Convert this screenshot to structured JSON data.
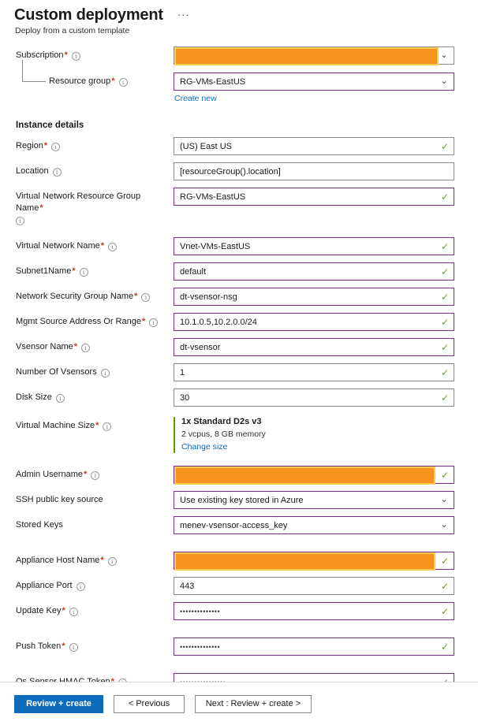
{
  "header": {
    "title": "Custom deployment",
    "subtitle": "Deploy from a custom template",
    "more_menu": "···"
  },
  "sections": {
    "instance_details_heading": "Instance details"
  },
  "labels": {
    "subscription": "Subscription",
    "resource_group": "Resource group",
    "region": "Region",
    "location": "Location",
    "vnet_rg_name": "Virtual Network Resource Group Name",
    "vnet_name": "Virtual Network Name",
    "subnet1_name": "Subnet1Name",
    "nsg_name": "Network Security Group Name",
    "mgmt_source": "Mgmt Source Address Or Range",
    "vsensor_name": "Vsensor Name",
    "number_of_vsensors": "Number Of Vsensors",
    "disk_size": "Disk Size",
    "vm_size": "Virtual Machine Size",
    "admin_username": "Admin Username",
    "ssh_key_source": "SSH public key source",
    "stored_keys": "Stored Keys",
    "appliance_host_name": "Appliance Host Name",
    "appliance_port": "Appliance Port",
    "update_key": "Update Key",
    "push_token": "Push Token",
    "os_sensor_hmac_token": "Os Sensor HMAC Token"
  },
  "values": {
    "subscription": "",
    "resource_group": "RG-VMs-EastUS",
    "create_new_link": "Create new",
    "region": "(US) East US",
    "location": "[resourceGroup().location]",
    "vnet_rg_name": "RG-VMs-EastUS",
    "vnet_name": "Vnet-VMs-EastUS",
    "subnet1_name": "default",
    "nsg_name": "dt-vsensor-nsg",
    "mgmt_source": "10.1.0.5,10.2.0.0/24",
    "vsensor_name": "dt-vsensor",
    "number_of_vsensors": "1",
    "disk_size": "30",
    "admin_username": "",
    "ssh_key_source": "Use existing key stored in Azure",
    "stored_keys": "menev-vsensor-access_key",
    "appliance_host_name": "",
    "appliance_port": "443",
    "update_key": "••••••••••••••",
    "push_token": "••••••••••••••",
    "os_sensor_hmac_token": "••••••••••••••••"
  },
  "vm_size": {
    "name": "1x Standard D2s v3",
    "spec": "2 vcpus, 8 GB memory",
    "change_link": "Change size"
  },
  "footer": {
    "review_create": "Review + create",
    "previous": "< Previous",
    "next": "Next : Review + create >"
  },
  "icons": {
    "info": "i",
    "required": "*",
    "chevron_down": "⌄",
    "check": "✓"
  },
  "colors": {
    "accent": "#0f6cbd",
    "redaction": "#f7941e",
    "redaction_border": "#ffcc4d",
    "field_border_highlight": "#7d2b8b",
    "field_border": "#8a8a8a",
    "valid_check": "#5aa80d",
    "required_asterisk": "#c0392b",
    "vm_accent": "#57a300"
  }
}
